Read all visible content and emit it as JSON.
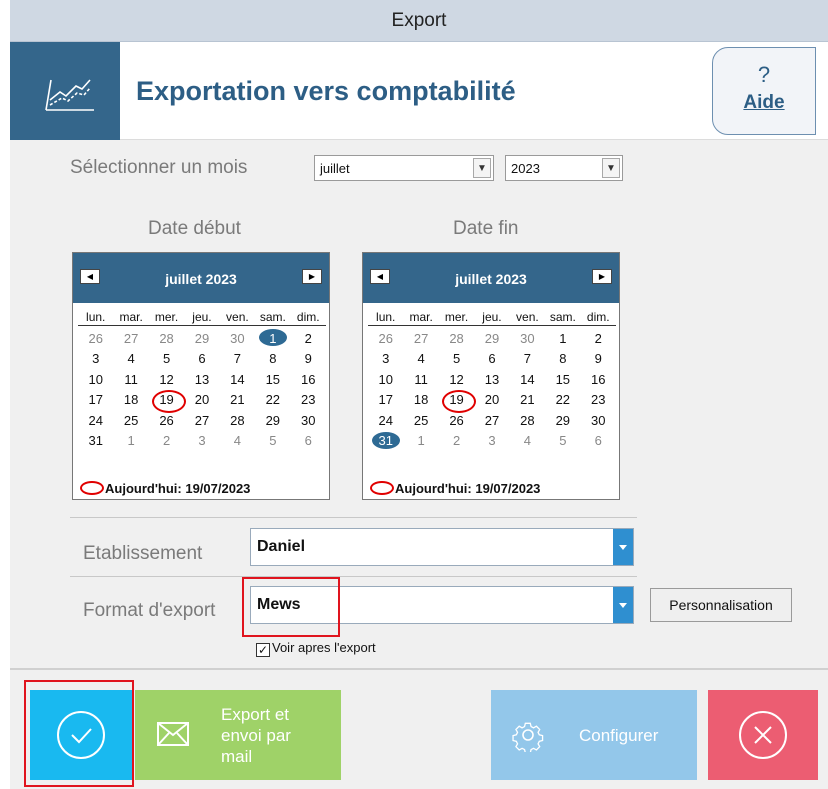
{
  "window": {
    "title": "Export"
  },
  "header": {
    "title": "Exportation vers comptabilité",
    "help_icon": "?",
    "help_label": "Aide",
    "icon": "chart-trend-icon"
  },
  "month_picker": {
    "label": "Sélectionner un mois",
    "month": "juillet",
    "year": "2023"
  },
  "start_date": {
    "label": "Date début",
    "month_title": "juillet 2023",
    "weekdays": [
      "lun.",
      "mar.",
      "mer.",
      "jeu.",
      "ven.",
      "sam.",
      "dim."
    ],
    "weeks": [
      [
        "26",
        "27",
        "28",
        "29",
        "30",
        "1",
        "2"
      ],
      [
        "3",
        "4",
        "5",
        "6",
        "7",
        "8",
        "9"
      ],
      [
        "10",
        "11",
        "12",
        "13",
        "14",
        "15",
        "16"
      ],
      [
        "17",
        "18",
        "19",
        "20",
        "21",
        "22",
        "23"
      ],
      [
        "24",
        "25",
        "26",
        "27",
        "28",
        "29",
        "30"
      ],
      [
        "31",
        "1",
        "2",
        "3",
        "4",
        "5",
        "6"
      ]
    ],
    "selected": "1",
    "today_text": "Aujourd'hui: 19/07/2023"
  },
  "end_date": {
    "label": "Date fin",
    "month_title": "juillet 2023",
    "weekdays": [
      "lun.",
      "mar.",
      "mer.",
      "jeu.",
      "ven.",
      "sam.",
      "dim."
    ],
    "weeks": [
      [
        "26",
        "27",
        "28",
        "29",
        "30",
        "1",
        "2"
      ],
      [
        "3",
        "4",
        "5",
        "6",
        "7",
        "8",
        "9"
      ],
      [
        "10",
        "11",
        "12",
        "13",
        "14",
        "15",
        "16"
      ],
      [
        "17",
        "18",
        "19",
        "20",
        "21",
        "22",
        "23"
      ],
      [
        "24",
        "25",
        "26",
        "27",
        "28",
        "29",
        "30"
      ],
      [
        "31",
        "1",
        "2",
        "3",
        "4",
        "5",
        "6"
      ]
    ],
    "selected": "31",
    "today_text": "Aujourd'hui: 19/07/2023"
  },
  "establishment": {
    "label": "Etablissement",
    "value": "Daniel"
  },
  "export_format": {
    "label": "Format d'export",
    "value": "Mews",
    "customize_label": "Personnalisation"
  },
  "show_after_export": {
    "label": "Voir apres l'export",
    "checked": true
  },
  "actions": {
    "validate_icon": "check-circle-icon",
    "mail_label_1": "Export et",
    "mail_label_2": "envoi par",
    "mail_label_3": "mail",
    "configure_label": "Configurer",
    "cancel_icon": "close-circle-icon"
  },
  "colors": {
    "brand": "#34668b",
    "validate": "#19b9f0",
    "mail": "#9fd268",
    "configure": "#93c7ea",
    "cancel": "#ec5d72",
    "highlight": "#e0141e"
  }
}
